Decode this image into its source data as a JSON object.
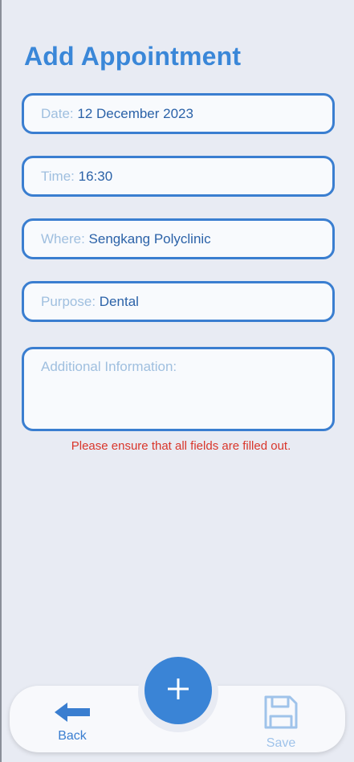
{
  "page": {
    "title": "Add Appointment"
  },
  "form": {
    "date": {
      "label": "Date:",
      "value": "12 December 2023"
    },
    "time": {
      "label": "Time:",
      "value": "16:30"
    },
    "where": {
      "label": "Where:",
      "value": "Sengkang Polyclinic"
    },
    "purpose": {
      "label": "Purpose:",
      "value": "Dental"
    },
    "additional_info": {
      "label": "Additional Information:",
      "value": ""
    }
  },
  "error_message": "Please ensure that all fields are filled out.",
  "bottom_nav": {
    "back_label": "Back",
    "save_label": "Save",
    "add_icon": "plus-icon",
    "back_icon": "arrow-left-icon",
    "save_icon": "floppy-disk-icon"
  },
  "colors": {
    "accent": "#3a84d6",
    "field_border": "#3a7ed0",
    "label": "#9fbfdf",
    "value": "#2b62a8",
    "error": "#d9362b",
    "background": "#e8ebf3",
    "save_disabled": "#9fc3ea"
  }
}
